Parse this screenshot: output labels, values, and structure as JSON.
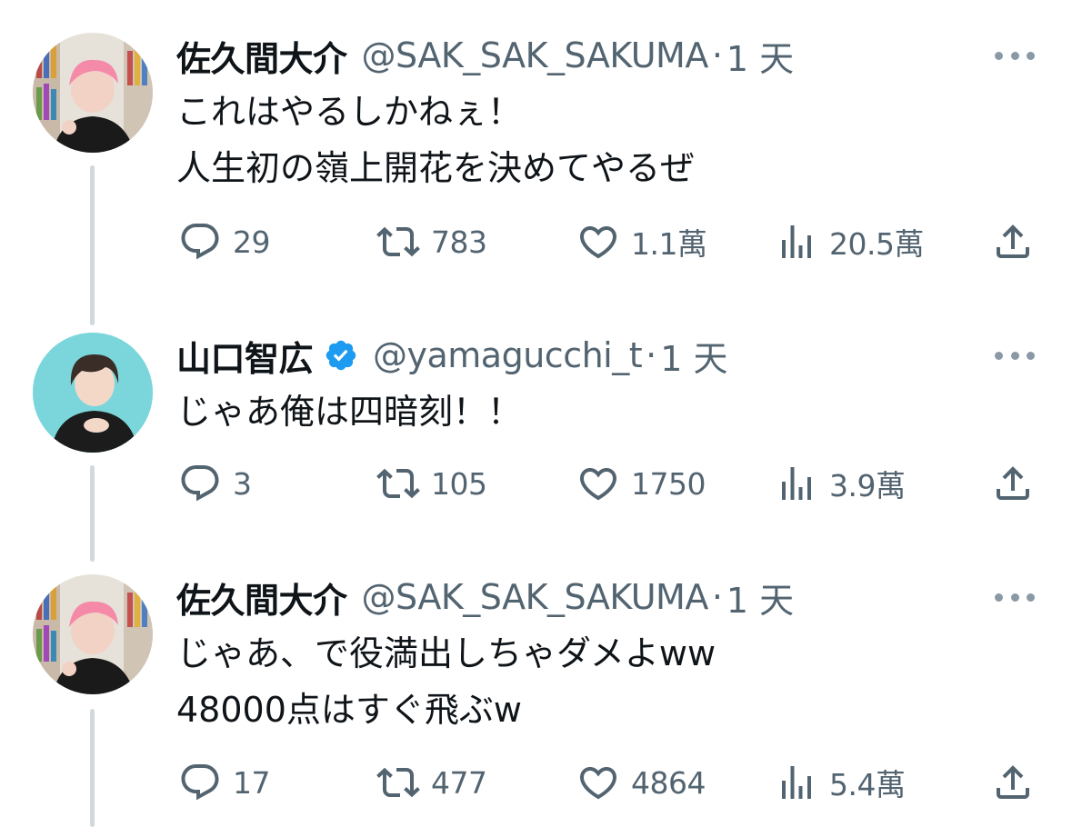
{
  "tweets": [
    {
      "name": "佐久間大介",
      "handle": "@SAK_SAK_SAKUMA",
      "dot": "·",
      "time": "1 天",
      "lines": [
        "これはやるしかねぇ！",
        "人生初の嶺上開花を決めてやるぜ"
      ],
      "replies": "29",
      "retweets": "783",
      "likes": "1.1萬",
      "views": "20.5萬",
      "verified": false
    },
    {
      "name": "山口智広",
      "handle": "@yamagucchi_t",
      "dot": "·",
      "time": "1 天",
      "lines": [
        "じゃあ俺は四暗刻！！"
      ],
      "replies": "3",
      "retweets": "105",
      "likes": "1750",
      "views": "3.9萬",
      "verified": true
    },
    {
      "name": "佐久間大介",
      "handle": "@SAK_SAK_SAKUMA",
      "dot": "·",
      "time": "1 天",
      "lines": [
        "じゃあ、で役満出しちゃダメよww",
        "48000点はすぐ飛ぶw"
      ],
      "replies": "17",
      "retweets": "477",
      "likes": "4864",
      "views": "5.4萬",
      "verified": false
    }
  ],
  "icons": {
    "reply": "reply-icon",
    "retweet": "retweet-icon",
    "like": "heart-icon",
    "views": "views-icon",
    "share": "share-icon",
    "more": "more-icon",
    "verified": "verified-badge-icon"
  },
  "colors": {
    "text": "#0f1419",
    "secondary": "#536471",
    "thread_line": "#cfd9de",
    "verified": "#1d9bf0"
  }
}
